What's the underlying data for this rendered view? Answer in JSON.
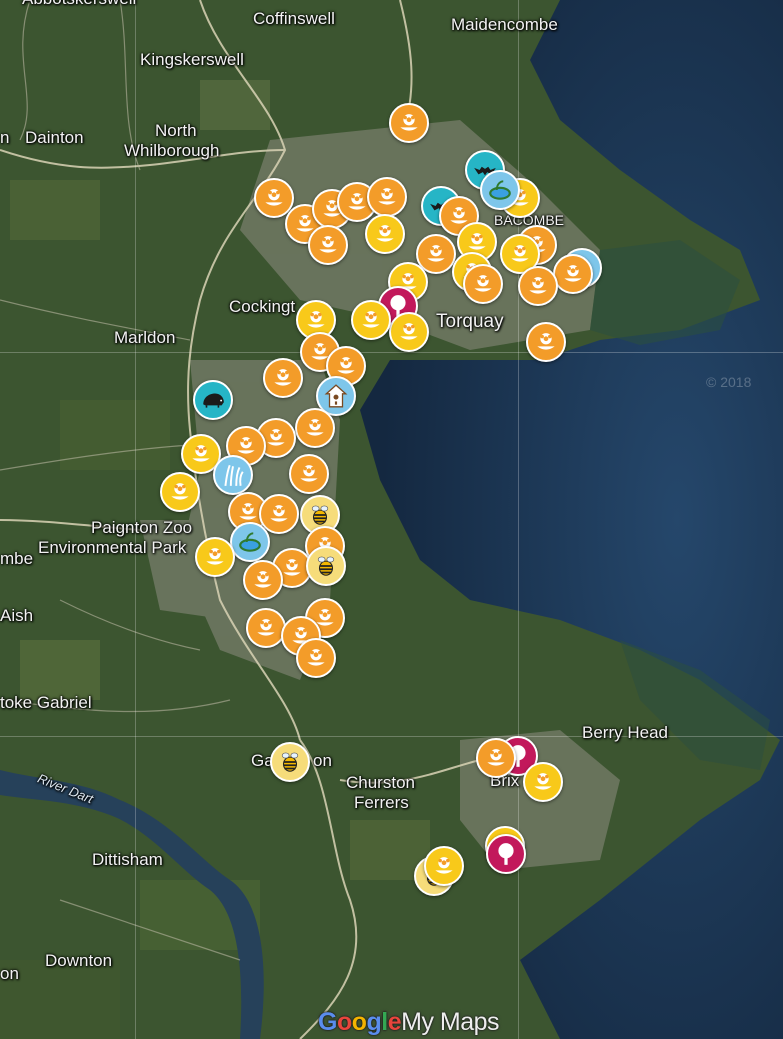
{
  "map": {
    "places": [
      {
        "id": "abbotskerswell",
        "text": "Abbotskerswell"
      },
      {
        "id": "coffinswell",
        "text": "Coffinswell"
      },
      {
        "id": "maidencombe",
        "text": "Maidencombe"
      },
      {
        "id": "kingskerswell",
        "text": "Kingskerswell"
      },
      {
        "id": "dainton",
        "text": "Dainton"
      },
      {
        "id": "n-left",
        "text": "n"
      },
      {
        "id": "north",
        "text": "North"
      },
      {
        "id": "whilborough",
        "text": "Whilborough"
      },
      {
        "id": "babbacombe",
        "text": "BACOMBE"
      },
      {
        "id": "cockington",
        "text": "Cockingt"
      },
      {
        "id": "marldon",
        "text": "Marldon"
      },
      {
        "id": "torquay",
        "text": "Torquay"
      },
      {
        "id": "paignton-zoo",
        "text": "Paignton Zoo"
      },
      {
        "id": "env-park",
        "text": "Environmental Park"
      },
      {
        "id": "mbe",
        "text": "mbe"
      },
      {
        "id": "aish",
        "text": "Aish"
      },
      {
        "id": "stoke-gabriel",
        "text": "toke Gabriel"
      },
      {
        "id": "river-dart",
        "text": "River Dart"
      },
      {
        "id": "galmpton-a",
        "text": "Ga"
      },
      {
        "id": "galmpton-b",
        "text": "on"
      },
      {
        "id": "churston",
        "text": "Churston"
      },
      {
        "id": "ferrers",
        "text": "Ferrers"
      },
      {
        "id": "berry-head",
        "text": "Berry Head"
      },
      {
        "id": "brixham",
        "text": "Brix"
      },
      {
        "id": "dittisham",
        "text": "Dittisham"
      },
      {
        "id": "downton",
        "text": "Downton"
      },
      {
        "id": "on-left",
        "text": "on"
      }
    ],
    "watermark": "© 2018",
    "attribution": {
      "g1": "G",
      "g2": "o",
      "g3": "o",
      "g4": "g",
      "g5": "l",
      "g6": "e",
      "brand": "My Maps"
    },
    "marker_types": {
      "flower": "flower-icon",
      "bird-box": "bird-box-icon",
      "hedgehog": "hedgehog-icon",
      "bee": "bee-icon",
      "tree": "tree-icon",
      "reeds": "reeds-icon",
      "pond": "pond-icon",
      "bat": "bat-icon"
    },
    "colors": {
      "orange": "#f39c29",
      "yellow": "#f8c91a",
      "teal": "#26b5c6",
      "sky": "#7ec6ea",
      "crimson": "#c2185b",
      "sea": "#1d3550"
    }
  }
}
